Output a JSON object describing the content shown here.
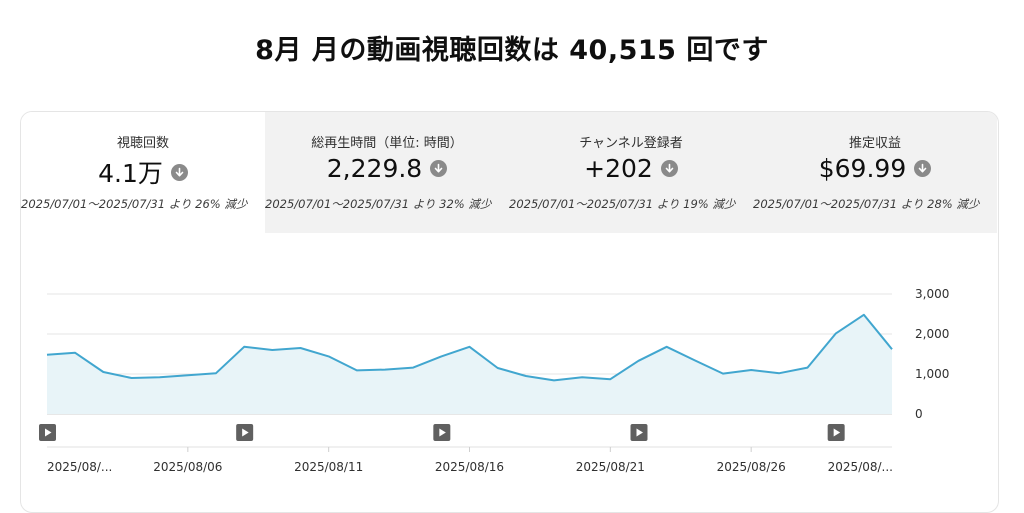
{
  "title": "8月 月の動画視聴回数は 40,515 回です",
  "metrics": [
    {
      "label": "視聴回数",
      "value": "4.1万",
      "comparison": "2025/07/01～2025/07/31 より 26% 減少",
      "selected": true
    },
    {
      "label": "総再生時間（単位: 時間）",
      "value": "2,229.8",
      "comparison": "2025/07/01～2025/07/31 より 32% 減少",
      "selected": false
    },
    {
      "label": "チャンネル登録者",
      "value": "+202",
      "comparison": "2025/07/01～2025/07/31 より 19% 減少",
      "selected": false
    },
    {
      "label": "推定収益",
      "value": "$69.99",
      "comparison": "2025/07/01～2025/07/31 より 28% 減少",
      "selected": false
    }
  ],
  "icons": {
    "metric_trend": "arrow-down-circle-icon",
    "video_marker": "play-icon"
  },
  "colors": {
    "line": "#41a6cf",
    "area_fill": "#e8f4f8",
    "grid": "#e5e5e5",
    "marker_bg": "#606060"
  },
  "chart_data": {
    "type": "area",
    "x_tick_labels": [
      "2025/08/...",
      "2025/08/06",
      "2025/08/11",
      "2025/08/16",
      "2025/08/21",
      "2025/08/26",
      "2025/08/..."
    ],
    "x_tick_days": [
      1,
      6,
      11,
      16,
      21,
      26,
      31
    ],
    "y_tick_labels": [
      "3,000",
      "2,000",
      "1,000",
      "0"
    ],
    "y_ticks": [
      3000,
      2000,
      1000,
      0
    ],
    "ylim": [
      0,
      3000
    ],
    "y_axis_side": "right",
    "grid": true,
    "x": [
      1,
      2,
      3,
      4,
      5,
      6,
      7,
      8,
      9,
      10,
      11,
      12,
      13,
      14,
      15,
      16,
      17,
      18,
      19,
      20,
      21,
      22,
      23,
      24,
      25,
      26,
      27,
      28,
      29,
      30,
      31
    ],
    "values": [
      1480,
      1530,
      1050,
      900,
      920,
      970,
      1020,
      1680,
      1600,
      1650,
      1440,
      1090,
      1110,
      1160,
      1440,
      1680,
      1150,
      950,
      840,
      920,
      870,
      1330,
      1680,
      1340,
      1010,
      1100,
      1020,
      1160,
      2010,
      2480,
      1620
    ],
    "video_markers_days": [
      1,
      8,
      15,
      22,
      29
    ]
  }
}
